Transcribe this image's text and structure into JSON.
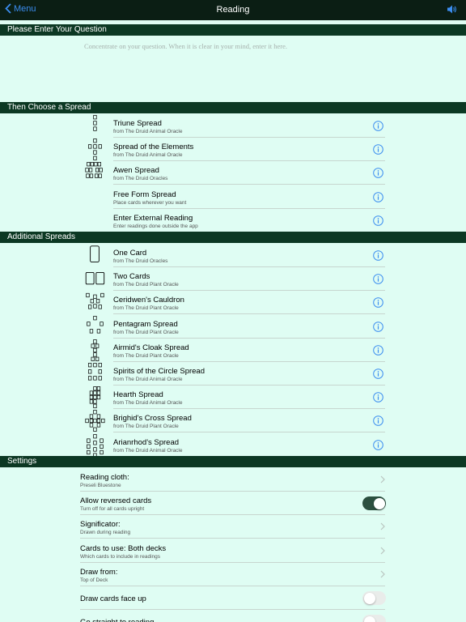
{
  "nav": {
    "back_label": "Menu",
    "title": "Reading",
    "speaker_icon": "speaker-icon",
    "accent_color": "#3b8df0"
  },
  "question": {
    "header": "Please Enter Your Question",
    "placeholder": "Concentrate on your question. When it is clear in your mind, enter it here."
  },
  "spreads": {
    "header": "Then Choose a Spread",
    "items": [
      {
        "title": "Triune Spread",
        "subtitle": "from The Druid Animal Oracle",
        "icon": "triune-spread-icon"
      },
      {
        "title": "Spread of the Elements",
        "subtitle": "from The Druid Animal Oracle",
        "icon": "elements-spread-icon"
      },
      {
        "title": "Awen Spread",
        "subtitle": "from The Druid Oracles",
        "icon": "awen-spread-icon"
      },
      {
        "title": "Free Form Spread",
        "subtitle": "Place cards wherever you want",
        "icon": ""
      },
      {
        "title": "Enter External Reading",
        "subtitle": "Enter readings done outside the app",
        "icon": ""
      }
    ]
  },
  "additional": {
    "header": "Additional Spreads",
    "items": [
      {
        "title": "One Card",
        "subtitle": "from The Druid Oracles",
        "icon": "one-card-icon"
      },
      {
        "title": "Two Cards",
        "subtitle": "from The Druid Plant Oracle",
        "icon": "two-cards-icon"
      },
      {
        "title": "Ceridwen's Cauldron",
        "subtitle": "from The Druid Plant Oracle",
        "icon": "cauldron-spread-icon"
      },
      {
        "title": "Pentagram Spread",
        "subtitle": "from The Druid Plant Oracle",
        "icon": "pentagram-spread-icon"
      },
      {
        "title": "Airmid's Cloak Spread",
        "subtitle": "from The Druid Plant Oracle",
        "icon": "cloak-spread-icon"
      },
      {
        "title": "Spirits of the Circle Spread",
        "subtitle": "from The Druid Animal Oracle",
        "icon": "circle-spread-icon"
      },
      {
        "title": "Hearth Spread",
        "subtitle": "from The Druid Animal Oracle",
        "icon": "hearth-spread-icon"
      },
      {
        "title": "Brighid's Cross Spread",
        "subtitle": "from The Druid Plant Oracle",
        "icon": "cross-spread-icon"
      },
      {
        "title": "Arianrhod's Spread",
        "subtitle": "from The Druid Animal Oracle",
        "icon": "arianrhod-spread-icon"
      }
    ]
  },
  "settings": {
    "header": "Settings",
    "items": [
      {
        "title": "Reading cloth:",
        "subtitle": "Preseli Bluestone",
        "control": "chevron"
      },
      {
        "title": "Allow reversed cards",
        "subtitle": "Turn off for all cards upright",
        "control": "toggle",
        "on": true
      },
      {
        "title": "Significator:",
        "subtitle": "Drawn during reading",
        "control": "chevron"
      },
      {
        "title": "Cards to use: Both decks",
        "subtitle": "Which cards to include in readings",
        "control": "chevron"
      },
      {
        "title": "Draw from:",
        "subtitle": "Top of Deck",
        "control": "chevron"
      },
      {
        "title": "Draw cards face up",
        "subtitle": "",
        "control": "toggle",
        "on": false
      },
      {
        "title": "Go straight to reading",
        "subtitle": "",
        "control": "toggle",
        "on": false
      }
    ]
  }
}
